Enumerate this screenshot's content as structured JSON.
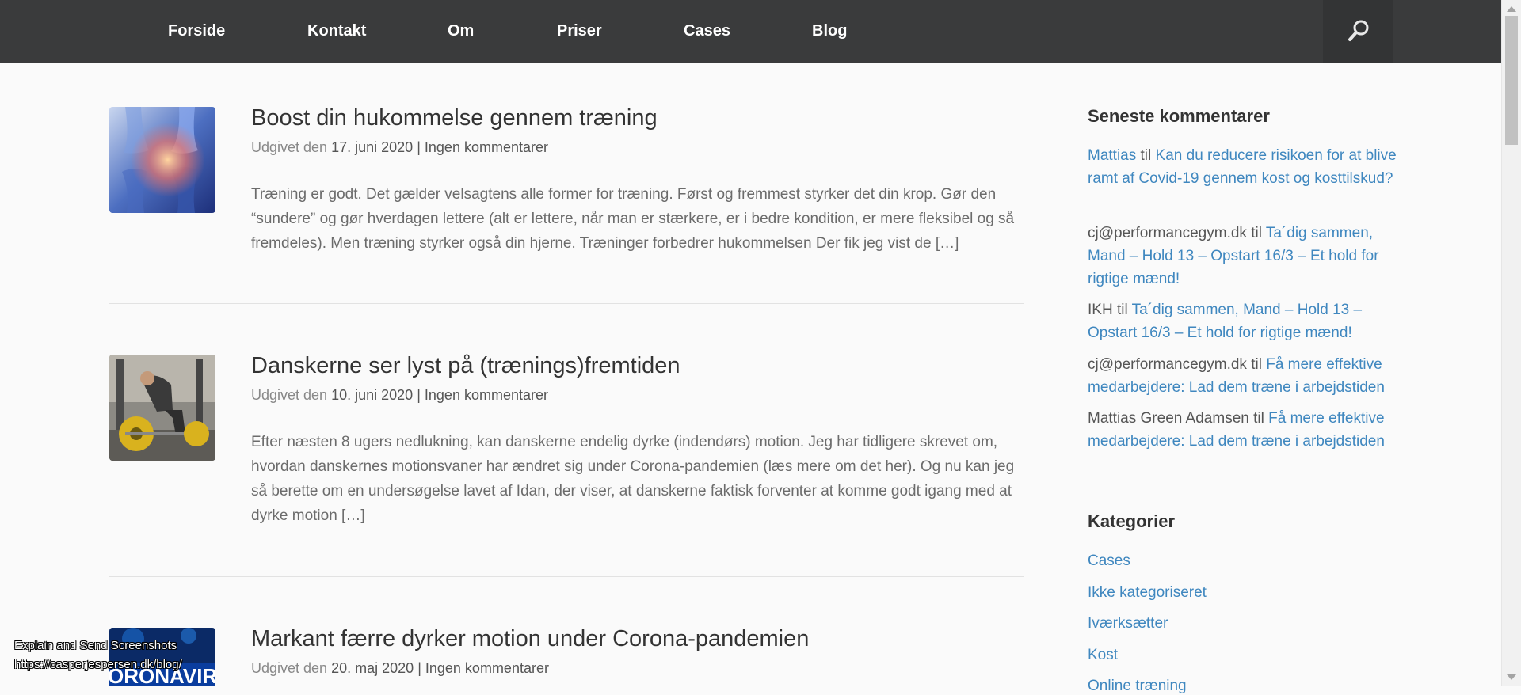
{
  "nav": {
    "items": [
      "Forside",
      "Kontakt",
      "Om",
      "Priser",
      "Cases",
      "Blog"
    ],
    "search_icon": "search-icon"
  },
  "posts": [
    {
      "title": "Boost din hukommelse gennem træning",
      "meta_prefix": "Udgivet den",
      "date": "17. juni 2020",
      "separator": "|",
      "comments": "Ingen kommentarer",
      "excerpt": "Træning er godt. Det gælder velsagtens alle former for træning. Først og fremmest styrker det din krop. Gør den “sundere” og gør hverdagen lettere (alt er lettere, når man er stærkere, er i bedre kondition, er mere fleksibel og så fremdeles). Men træning styrker også din hjerne. Træninger forbedrer hukommelsen Der fik jeg vist de […]"
    },
    {
      "title": "Danskerne ser lyst på (trænings)fremtiden",
      "meta_prefix": "Udgivet den",
      "date": "10. juni 2020",
      "separator": "|",
      "comments": "Ingen kommentarer",
      "excerpt": "Efter næsten 8 ugers nedlukning, kan danskerne endelig dyrke (indendørs) motion. Jeg har tidligere skrevet om, hvordan danskernes motionsvaner har ændret sig under Corona-pandemien (læs mere om det her). Og nu kan jeg så berette om en undersøgelse lavet af Idan, der viser, at danskerne faktisk forventer at komme godt igang med at dyrke motion […]"
    },
    {
      "title": "Markant færre dyrker motion under Corona-pandemien",
      "meta_prefix": "Udgivet den",
      "date": "20. maj 2020",
      "separator": "|",
      "comments": "Ingen kommentarer",
      "thumb_text": "ORONAVIRU"
    }
  ],
  "sidebar": {
    "recent_comments_title": "Seneste kommentarer",
    "comments": [
      {
        "author": "Mattias",
        "author_is_link": true,
        "connector": "til",
        "post": "Kan du reducere risikoen for at blive ramt af Covid-19 gennem kost og kosttilskud?"
      },
      {
        "author": "cj@performancegym.dk",
        "author_is_link": false,
        "connector": "til",
        "post": "Ta´dig sammen, Mand – Hold 13 – Opstart 16/3 – Et hold for rigtige mænd!"
      },
      {
        "author": "IKH",
        "author_is_link": false,
        "connector": "til",
        "post": "Ta´dig sammen, Mand – Hold 13 – Opstart 16/3 – Et hold for rigtige mænd!"
      },
      {
        "author": "cj@performancegym.dk",
        "author_is_link": false,
        "connector": "til",
        "post": "Få mere effektive medarbejdere: Lad dem træne i arbejdstiden"
      },
      {
        "author": "Mattias Green Adamsen",
        "author_is_link": false,
        "connector": "til",
        "post": "Få mere effektive medarbejdere: Lad dem træne i arbejdstiden"
      }
    ],
    "categories_title": "Kategorier",
    "categories": [
      "Cases",
      "Ikke kategoriseret",
      "Iværksætter",
      "Kost",
      "Online træning"
    ]
  },
  "overlay": {
    "line1": "Explain and Send Screenshots",
    "line2": "https://casperjespersen.dk/blog/"
  },
  "colors": {
    "nav_bg": "#3a3b3c",
    "link": "#3f87bf",
    "title": "#333333",
    "text": "#6b6b6b"
  }
}
